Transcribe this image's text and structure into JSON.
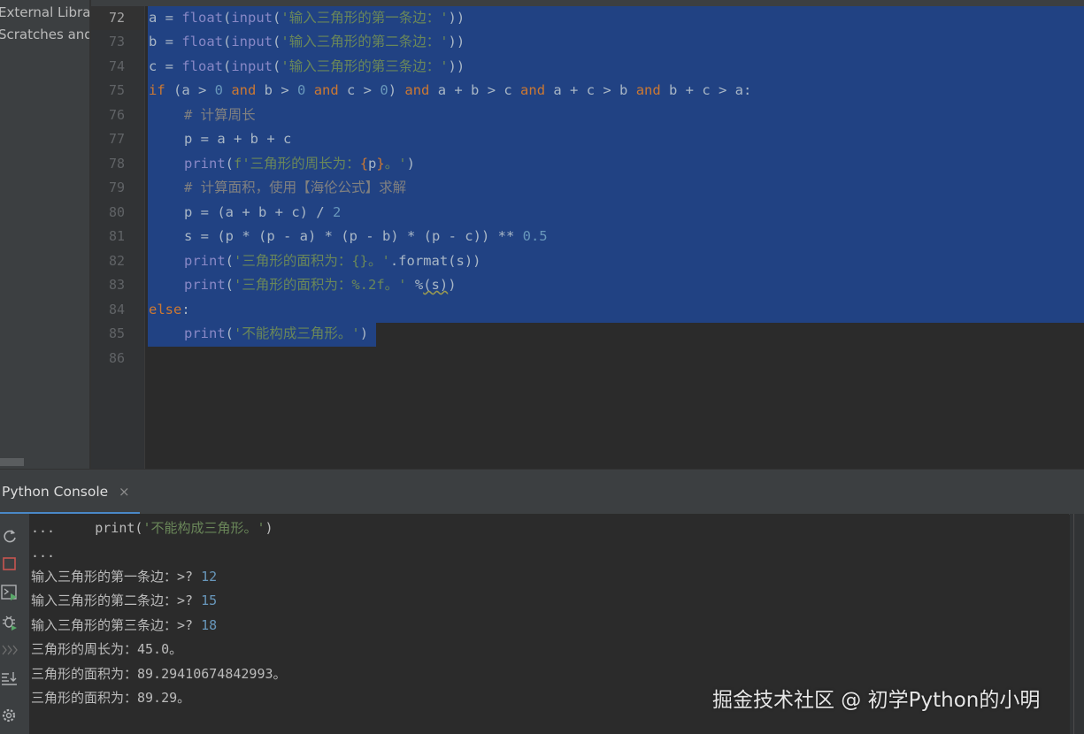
{
  "project_tree": {
    "items": [
      "External Librar",
      "Scratches and"
    ]
  },
  "editor": {
    "line_numbers": [
      "72",
      "73",
      "74",
      "75",
      "76",
      "77",
      "78",
      "79",
      "80",
      "81",
      "82",
      "83",
      "84",
      "85",
      "86"
    ],
    "current_line": "72",
    "lines": {
      "l72": {
        "a": "a = ",
        "b": "float",
        "c": "(",
        "d": "input",
        "e": "(",
        "f": "'输入三角形的第一条边：'",
        "g": "))"
      },
      "l73": {
        "a": "b = ",
        "b": "float",
        "c": "(",
        "d": "input",
        "e": "(",
        "f": "'输入三角形的第二条边：'",
        "g": "))"
      },
      "l74": {
        "a": "c = ",
        "b": "float",
        "c": "(",
        "d": "input",
        "e": "(",
        "f": "'输入三角形的第三条边：'",
        "g": "))"
      },
      "l75": {
        "k1": "if",
        "t1": " (a > ",
        "n1": "0",
        "k2": " and",
        "t2": " b > ",
        "n2": "0",
        "k3": " and",
        "t3": " c > ",
        "n3": "0",
        "t4": ") ",
        "k4": "and",
        "t5": " a + b > c ",
        "k5": "and",
        "t6": " a + c > b ",
        "k6": "and",
        "t7": " b + c > a:"
      },
      "l76": {
        "c": "# 计算周长"
      },
      "l77": {
        "t": "p = a + b + c"
      },
      "l78": {
        "b": "print",
        "t1": "(",
        "s1": "f'三角形的周长为：",
        "f1": "{",
        "t2": "p",
        "f2": "}",
        "s2": "。'",
        "t3": ")"
      },
      "l79": {
        "c": "# 计算面积，使用【海伦公式】求解"
      },
      "l80": {
        "t1": "p = (a + b + c) / ",
        "n1": "2"
      },
      "l81": {
        "t1": "s = (p * (p - a) * (p - b) * (p - c)) ** ",
        "n1": "0.5"
      },
      "l82": {
        "b": "print",
        "t1": "(",
        "s1": "'三角形的面积为：{}。'",
        "t2": ".format(s))"
      },
      "l83": {
        "b": "print",
        "t1": "(",
        "s1": "'三角形的面积为：%.2f。'",
        "t2": " %",
        "sq": "(s)",
        "t3": ")"
      },
      "l84": {
        "k": "else",
        "t": ":"
      },
      "l85": {
        "b": "print",
        "t1": "(",
        "s1": "'不能构成三角形。'",
        "t2": ")"
      }
    }
  },
  "console": {
    "tab_label": "Python Console",
    "tab_close": "×",
    "lines": [
      {
        "prompt": "...     ",
        "b": "print",
        "t1": "(",
        "s1": "'不能构成三角形。'",
        "t2": ")"
      },
      {
        "text": "..."
      },
      {
        "prompt": "输入三角形的第一条边：>? ",
        "value": "12"
      },
      {
        "prompt": "输入三角形的第二条边：>? ",
        "value": "15"
      },
      {
        "prompt": "输入三角形的第三条边：>? ",
        "value": "18"
      },
      {
        "text": "三角形的周长为：45.0。"
      },
      {
        "text": "三角形的面积为：89.29410674842993。"
      },
      {
        "text": "三角形的面积为：89.29。"
      }
    ],
    "toolbar_icons": [
      "rerun-icon",
      "stop-icon",
      "console-run-icon",
      "debug-icon",
      "history-icon",
      "scroll-to-end-icon",
      "settings-icon"
    ]
  },
  "watermark": "掘金技术社区 @ 初学Python的小明",
  "colors": {
    "selection": "#214283",
    "keyword": "#cc7832",
    "builtin": "#8888c6",
    "string": "#6a8759",
    "number": "#6897bb",
    "comment": "#808080",
    "stop_icon": "#c75450",
    "tab_underline": "#4a88c7"
  }
}
